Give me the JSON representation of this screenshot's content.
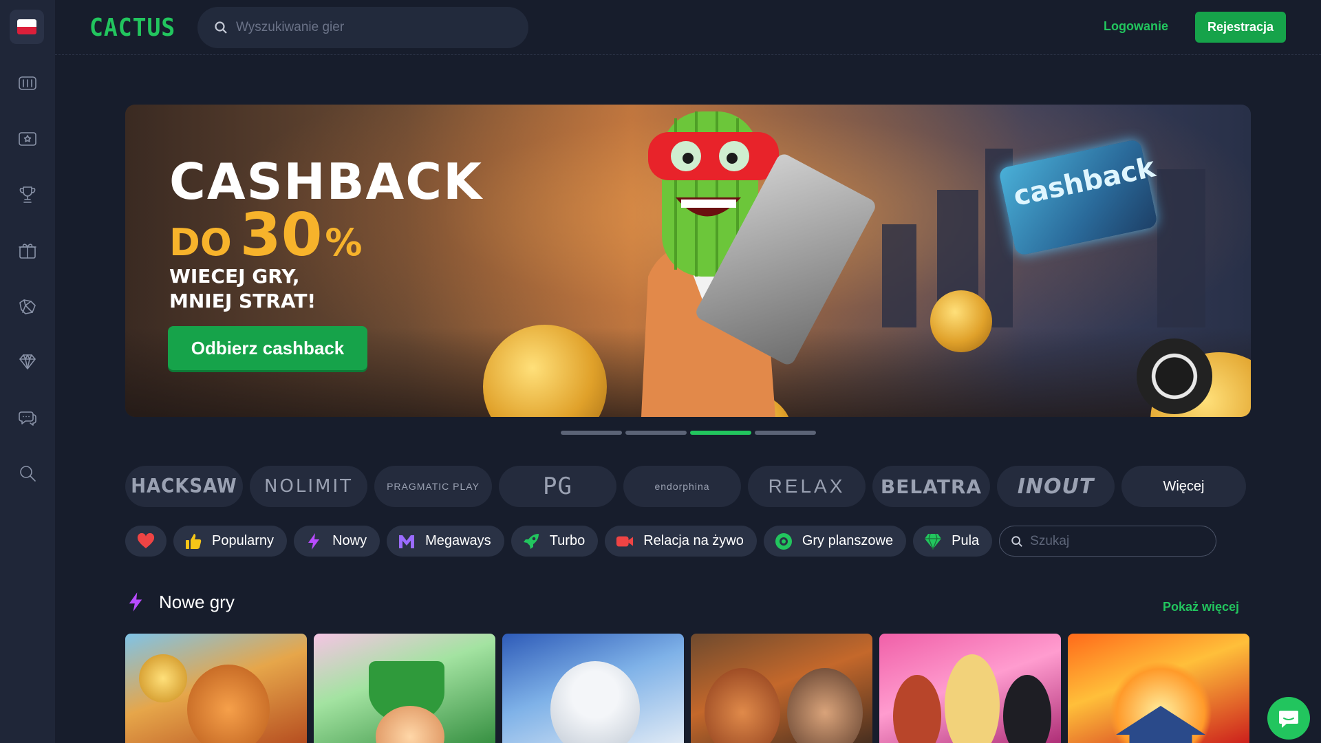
{
  "header": {
    "logo": "CACTUS",
    "search_placeholder": "Wyszukiwanie gier",
    "login": "Logowanie",
    "register": "Rejestracja"
  },
  "sidebar": {
    "language": "pl",
    "items": [
      {
        "icon": "slots-icon"
      },
      {
        "icon": "live-casino-icon"
      },
      {
        "icon": "tournaments-icon"
      },
      {
        "icon": "promotions-icon"
      },
      {
        "icon": "sports-icon"
      },
      {
        "icon": "vip-diamond-icon"
      },
      {
        "icon": "chat-icon"
      },
      {
        "icon": "search-icon"
      }
    ]
  },
  "banner": {
    "title": "CASHBACK",
    "do": "DO",
    "percent": "30",
    "percent_sign": "%",
    "subtitle_1": "WIECEJ GRY,",
    "subtitle_2": "MNIEJ STRAT!",
    "button": "Odbierz cashback",
    "card_text": "cashback",
    "slide_count": 4,
    "active_slide": 3
  },
  "providers": [
    "HACKSAW",
    "NOLIMIT",
    "PRAGMATIC PLAY",
    "PG",
    "endorphina",
    "RELAX",
    "BELATRA",
    "INOUT"
  ],
  "providers_more": "Więcej",
  "categories": [
    {
      "label": "Popularny",
      "icon": "thumbs-up-icon",
      "color": "#f5c518"
    },
    {
      "label": "Nowy",
      "icon": "lightning-icon",
      "color": "#b84bff"
    },
    {
      "label": "Megaways",
      "icon": "megaways-icon",
      "color": "#9a6bff"
    },
    {
      "label": "Turbo",
      "icon": "rocket-icon",
      "color": "#22c55e"
    },
    {
      "label": "Relacja na żywo",
      "icon": "live-camera-icon",
      "color": "#ef4444"
    },
    {
      "label": "Gry planszowe",
      "icon": "board-games-icon",
      "color": "#22c55e"
    },
    {
      "label": "Pula",
      "icon": "jackpot-diamond-icon",
      "color": "#22c55e"
    }
  ],
  "category_search_placeholder": "Szukaj",
  "new_games": {
    "title": "Nowe gry",
    "show_more": "Pokaż więcej",
    "count": 6
  },
  "colors": {
    "accent": "#22c55e",
    "background": "#171d2c",
    "sidebar": "#1f2638"
  }
}
